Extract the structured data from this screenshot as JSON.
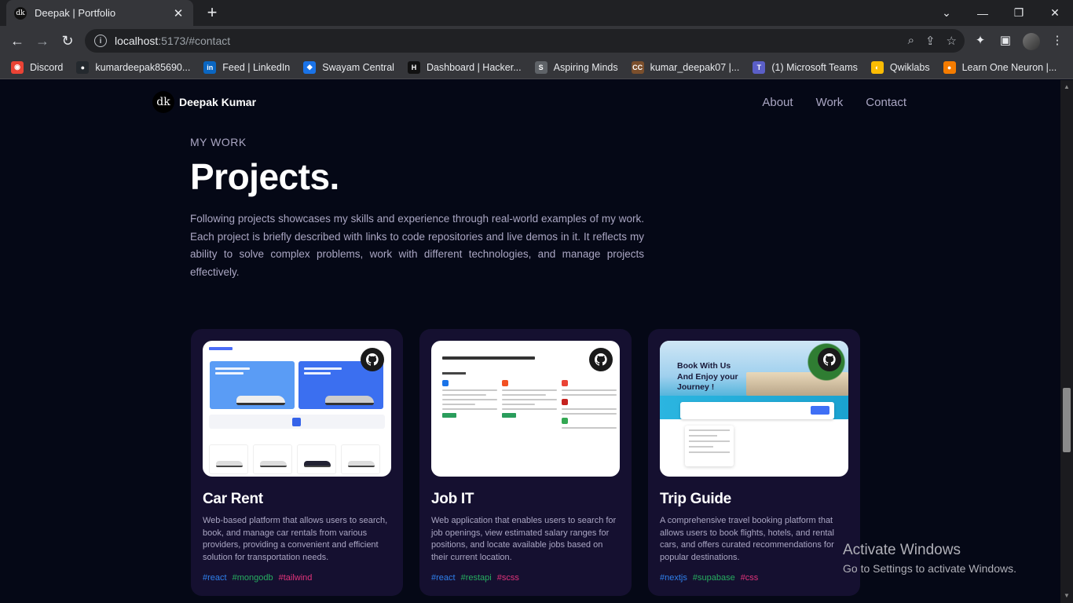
{
  "browser": {
    "tab_title": "Deepak | Portfolio",
    "tab_favicon_text": "dk",
    "url_host": "localhost",
    "url_rest": ":5173/#contact",
    "bookmarks": [
      {
        "label": "Discord",
        "icon": "discord-icon",
        "color": "#ea4335",
        "glyph": "◉"
      },
      {
        "label": "kumardeepak85690...",
        "icon": "github-icon",
        "color": "#24292e",
        "glyph": "●"
      },
      {
        "label": "Feed | LinkedIn",
        "icon": "linkedin-icon",
        "color": "#0a66c2",
        "glyph": "in"
      },
      {
        "label": "Swayam Central",
        "icon": "swayam-icon",
        "color": "#1a73e8",
        "glyph": "◆"
      },
      {
        "label": "Dashboard | Hacker...",
        "icon": "hackerrank-icon",
        "color": "#111111",
        "glyph": "H"
      },
      {
        "label": "Aspiring Minds",
        "icon": "aspiring-minds-icon",
        "color": "#5f6368",
        "glyph": "S"
      },
      {
        "label": "kumar_deepak07 |...",
        "icon": "codechef-icon",
        "color": "#7b4f2c",
        "glyph": "CC"
      },
      {
        "label": "(1) Microsoft Teams",
        "icon": "teams-icon",
        "color": "#5b5fc7",
        "glyph": "T"
      },
      {
        "label": "Qwiklabs",
        "icon": "qwiklabs-icon",
        "color": "#fbbc04",
        "glyph": "◐"
      },
      {
        "label": "Learn One Neuron |...",
        "icon": "oneneuron-icon",
        "color": "#f57c00",
        "glyph": "●"
      }
    ]
  },
  "site": {
    "brand": "Deepak Kumar",
    "logo_text": "dk",
    "nav": [
      "About",
      "Work",
      "Contact"
    ],
    "subtitle": "MY WORK",
    "title": "Projects.",
    "intro": "Following projects showcases my skills and experience through real-world examples of my work. Each project is briefly described with links to code repositories and live demos in it. It reflects my ability to solve complex problems, work with different technologies, and manage projects effectively."
  },
  "projects": [
    {
      "name": "Car Rent",
      "description": "Web-based platform that allows users to search, book, and manage car rentals from various providers, providing a convenient and efficient solution for transportation needs.",
      "tags": [
        {
          "name": "#react",
          "color": "#2f80ed"
        },
        {
          "name": "#mongodb",
          "color": "#27ae60"
        },
        {
          "name": "#tailwind",
          "color": "#e0337a"
        }
      ]
    },
    {
      "name": "Job IT",
      "description": "Web application that enables users to search for job openings, view estimated salary ranges for positions, and locate available jobs based on their current location.",
      "tags": [
        {
          "name": "#react",
          "color": "#2f80ed"
        },
        {
          "name": "#restapi",
          "color": "#27ae60"
        },
        {
          "name": "#scss",
          "color": "#e0337a"
        }
      ]
    },
    {
      "name": "Trip Guide",
      "description": "A comprehensive travel booking platform that allows users to book flights, hotels, and rental cars, and offers curated recommendations for popular destinations.",
      "tags": [
        {
          "name": "#nextjs",
          "color": "#2f80ed"
        },
        {
          "name": "#supabase",
          "color": "#27ae60"
        },
        {
          "name": "#css",
          "color": "#e0337a"
        }
      ]
    }
  ],
  "trip_preview_text": [
    "Book With Us",
    "And Enjoy your",
    "Journey !"
  ],
  "windows_watermark": {
    "line1": "Activate Windows",
    "line2": "Go to Settings to activate Windows."
  }
}
